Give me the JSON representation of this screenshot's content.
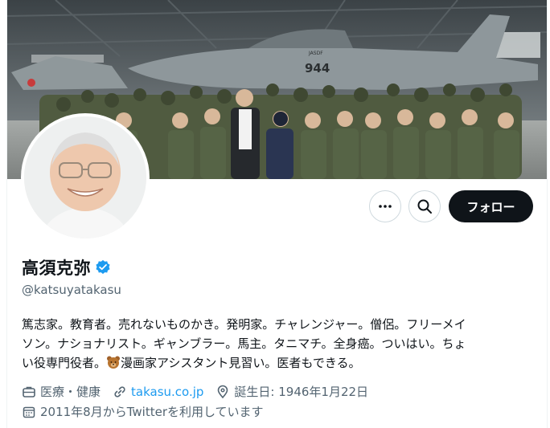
{
  "profile": {
    "display_name": "高須克弥",
    "handle": "@katsuyatakasu",
    "verified": true,
    "accent_color": "#1d9bf0",
    "bio": {
      "line1": "篤志家。教育者。売れないものかき。発明家。チャレンジャー。僧侶。フリーメイ",
      "line2": "ソン。ナショナリスト。ギャンブラー。馬主。タニマチ。全身癌。ついはい。ちょ",
      "line3_before_emoji": "い役専門役者。",
      "line3_emoji": "bear-face",
      "line3_after_emoji": "漫画家アシスタント見習い。医者もできる。"
    },
    "category": "医療・健康",
    "website": "takasu.co.jp",
    "birthday": "誕生日: 1946年1月22日",
    "joined": "2011年8月からTwitterを利用しています"
  },
  "banner": {
    "jet_tail_number": "944",
    "jet_nose_text": "JASDF"
  },
  "actions": {
    "more_icon": "more-dots-icon",
    "search_icon": "search-icon",
    "follow_label": "フォロー"
  },
  "icons": {
    "category": "briefcase-icon",
    "website": "link-icon",
    "birthday": "location-pin-icon",
    "joined": "calendar-icon"
  }
}
